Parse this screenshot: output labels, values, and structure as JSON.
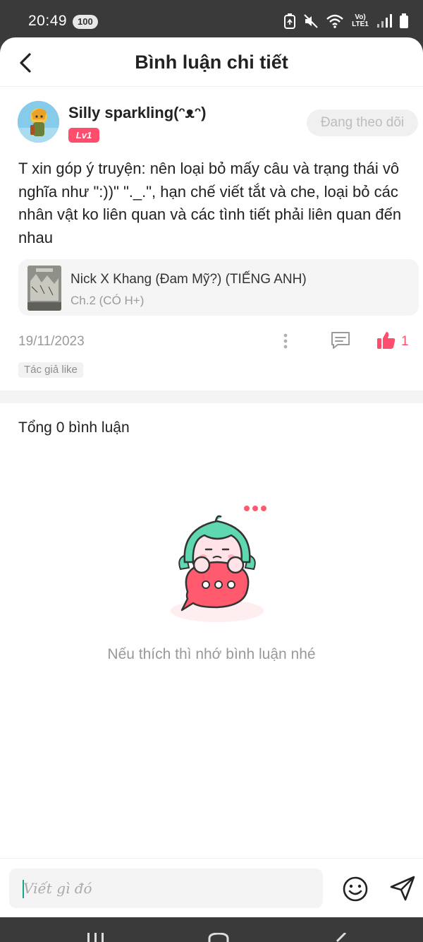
{
  "status_bar": {
    "time": "20:49",
    "battery_pill": "100",
    "network_label": "Vo) LTE1",
    "icons": [
      "battery-saver-icon",
      "mute-icon",
      "wifi-icon",
      "volte-icon",
      "signal-icon",
      "battery-icon"
    ]
  },
  "header": {
    "title": "Bình luận chi tiết",
    "back_icon": "chevron-left-icon"
  },
  "comment": {
    "username": "Silly sparkling(ᵔᴥᵔ)",
    "level": "Lv1",
    "follow_label": "Đang theo dõi",
    "text": "T xin góp ý truyện: nên loại bỏ mấy câu và trạng thái vô nghĩa như \":))\" \"._.\", hạn chế viết tắt và che, loại bỏ các nhân vật ko liên quan và các tình tiết phải liên quan đến nhau",
    "story": {
      "title": "Nick X Khang (Đam Mỹ?) (TIẾNG ANH)",
      "chapter": "Ch.2 (CÓ H+)"
    },
    "date": "19/11/2023",
    "like_count": "1",
    "author_like_tag": "Tác giả like"
  },
  "replies": {
    "total_label": "Tổng 0 bình luận",
    "empty_text": "Nếu thích thì nhớ bình luận nhé"
  },
  "input": {
    "placeholder": "Viết gì đó"
  },
  "colors": {
    "accent": "#ff4d6d",
    "text_primary": "#222222",
    "text_secondary": "#9a9a9a",
    "input_bg": "#f4f4f4",
    "mascot_hair": "#5fd8b2",
    "mascot_bubble": "#ff5a6e"
  }
}
